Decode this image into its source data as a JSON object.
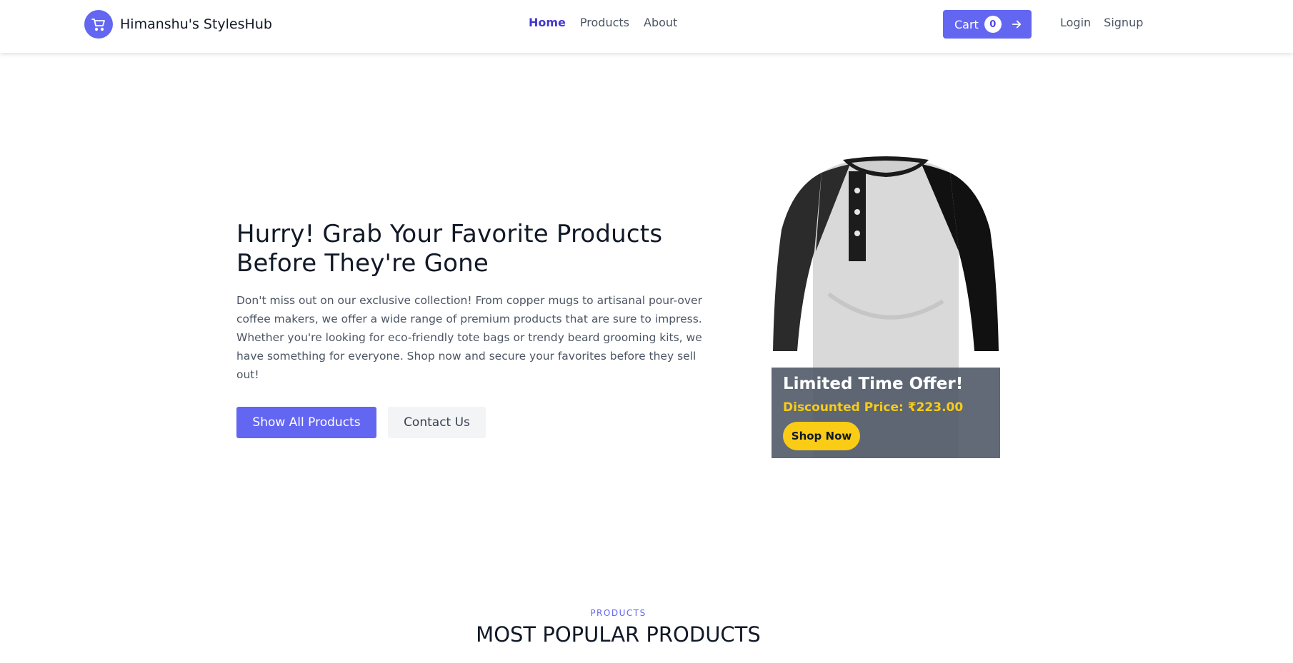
{
  "brand": {
    "name": "Himanshu's StylesHub",
    "logo_icon": "shopping-cart-icon",
    "accent": "#6366f1"
  },
  "nav": {
    "items": [
      {
        "label": "Home",
        "active": true
      },
      {
        "label": "Products",
        "active": false
      },
      {
        "label": "About",
        "active": false
      }
    ]
  },
  "cart": {
    "label": "Cart",
    "count": "0",
    "arrow_icon": "arrow-right-icon"
  },
  "auth": {
    "login": "Login",
    "signup": "Signup"
  },
  "hero": {
    "title": "Hurry! Grab Your Favorite Products Before They're Gone",
    "description": "Don't miss out on our exclusive collection! From copper mugs to artisanal pour-over coffee makers, we offer a wide range of premium products that are sure to impress. Whether you're looking for eco-friendly tote bags or trendy beard grooming kits, we have something for everyone. Shop now and secure your favorites before they sell out!",
    "primary_button": "Show All Products",
    "secondary_button": "Contact Us"
  },
  "offer": {
    "title": "Limited Time Offer!",
    "price": "Discounted Price: ₹223.00",
    "button": "Shop Now",
    "price_color": "#facc15"
  },
  "products_section": {
    "label": "PRODUCTS",
    "title": "MOST POPULAR PRODUCTS"
  }
}
